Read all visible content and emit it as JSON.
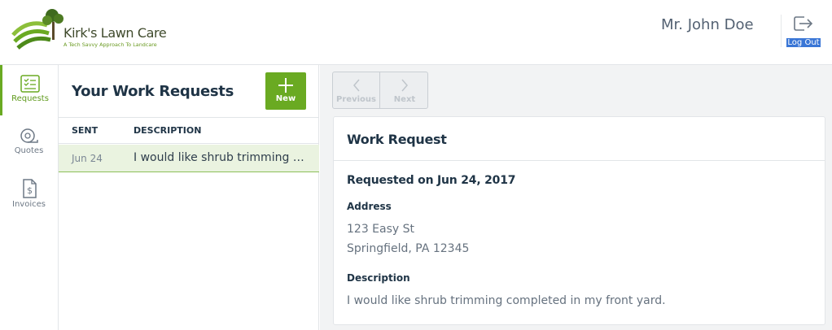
{
  "brand": {
    "name": "Kirk's Lawn Care",
    "tagline": "A Tech Savvy Approach To Landcare"
  },
  "header": {
    "user_name": "Mr. John Doe",
    "logout_label": "Log Out"
  },
  "nav": {
    "items": [
      {
        "label": "Requests",
        "icon": "checklist-icon",
        "active": true
      },
      {
        "label": "Quotes",
        "icon": "tape-measure-icon",
        "active": false
      },
      {
        "label": "Invoices",
        "icon": "invoice-dollar-icon",
        "active": false
      }
    ]
  },
  "list": {
    "title": "Your Work Requests",
    "new_label": "New",
    "columns": [
      "SENT",
      "DESCRIPTION"
    ],
    "rows": [
      {
        "sent": "Jun 24",
        "description": "I would like shrub trimming completed in my front yard."
      }
    ]
  },
  "pager": {
    "previous_label": "Previous",
    "next_label": "Next"
  },
  "detail": {
    "title": "Work Request",
    "requested_on": "Requested on Jun 24, 2017",
    "address_label": "Address",
    "address_line1": "123 Easy St",
    "address_line2": "Springfield, PA 12345",
    "description_label": "Description",
    "description": "I would like shrub trimming completed in my front yard."
  },
  "colors": {
    "accent_green": "#6aaa22",
    "selected_row": "#eaf3e0",
    "logout_highlight": "#3a76d6"
  }
}
